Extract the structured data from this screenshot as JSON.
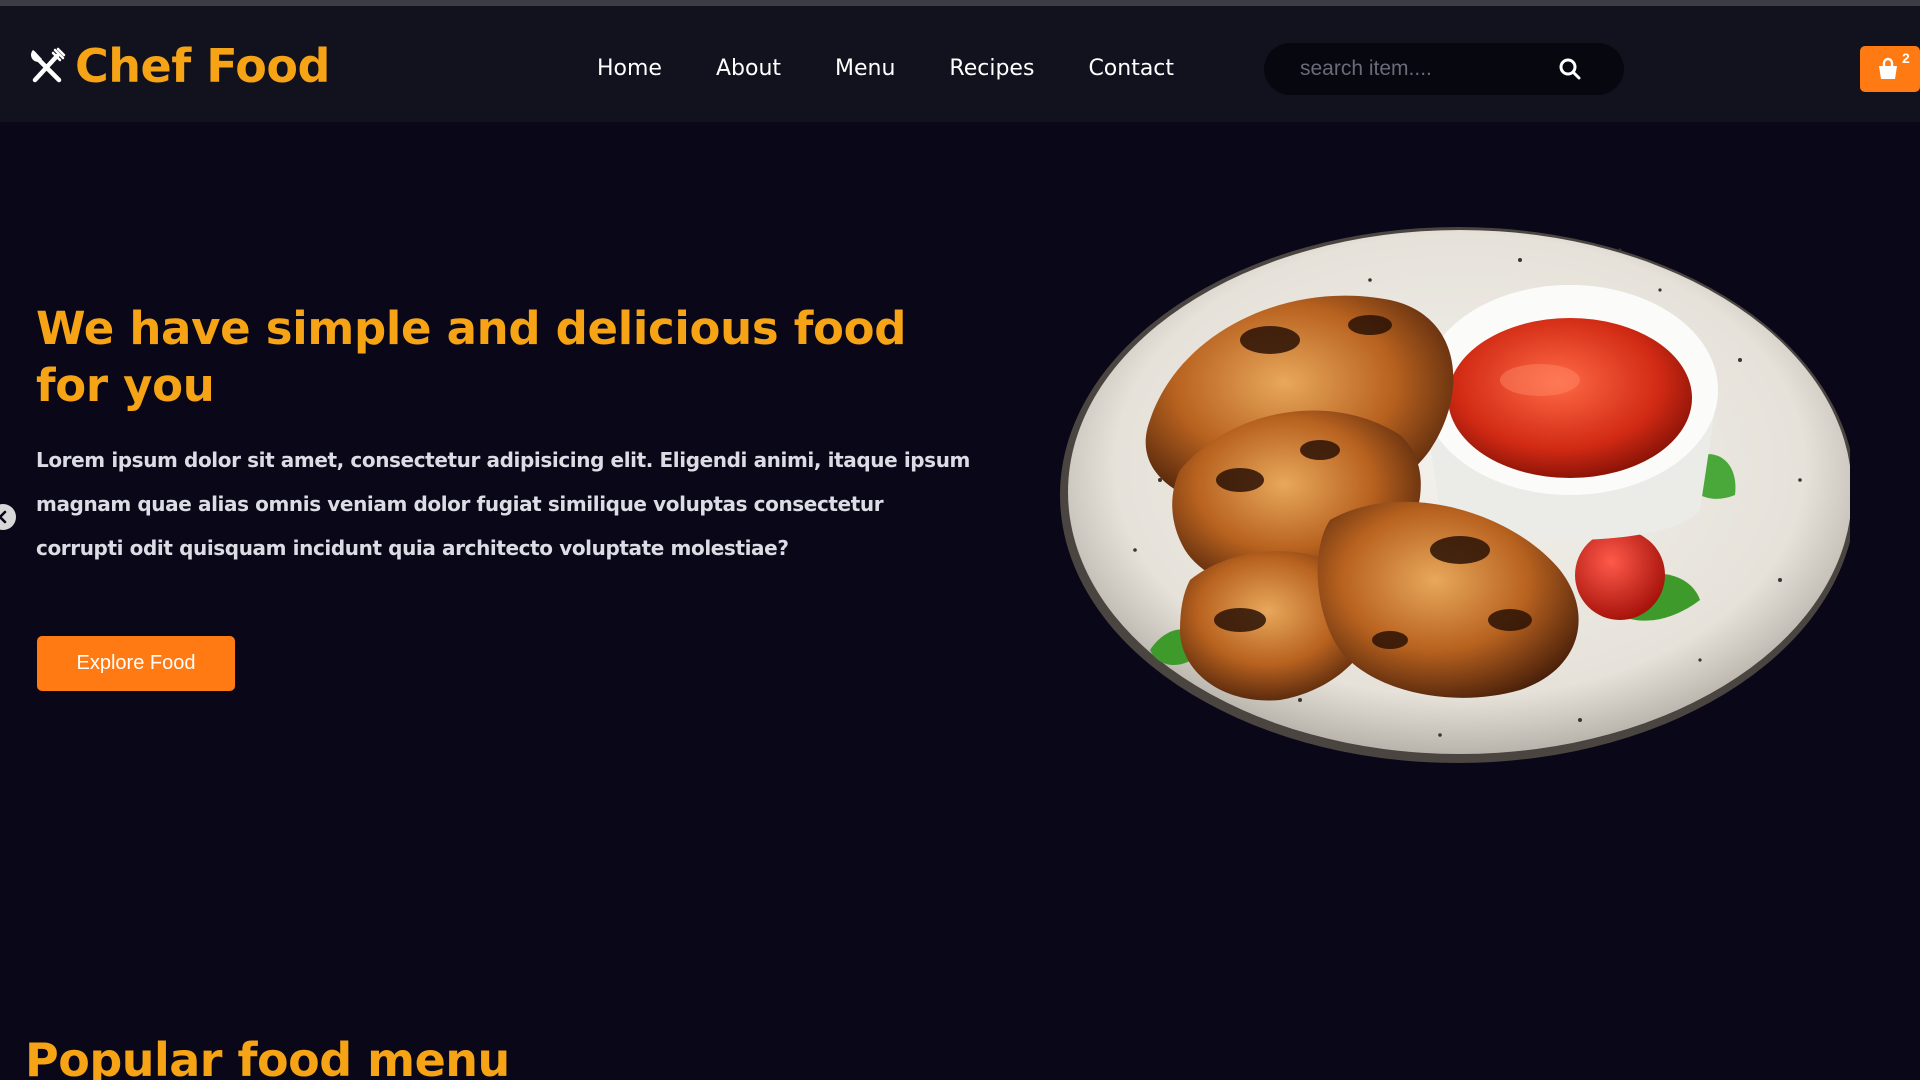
{
  "brand": {
    "name": "Chef Food",
    "icon": "fork-knife-icon"
  },
  "nav": {
    "items": [
      {
        "label": "Home"
      },
      {
        "label": "About"
      },
      {
        "label": "Menu"
      },
      {
        "label": "Recipes"
      },
      {
        "label": "Contact"
      }
    ]
  },
  "search": {
    "placeholder": "search item....",
    "icon": "search-icon"
  },
  "cart": {
    "icon": "shopping-bag-icon",
    "count": "2"
  },
  "hero": {
    "title": "We have simple and delicious food for you",
    "text": "Lorem ipsum dolor sit amet, consectetur adipisicing elit. Eligendi animi, itaque ipsum magnam quae alias omnis veniam dolor fugiat similique voluptas consectetur corrupti odit quisquam incidunt quia architecto voluptate molestiae?",
    "button_label": "Explore Food",
    "image": "grilled-chicken-wings-plate-image",
    "prev_icon": "chevron-left-icon"
  },
  "section": {
    "title": "Popular food menu"
  },
  "colors": {
    "background": "#0a0818",
    "header": "#12121e",
    "accent_yellow": "#f6a416",
    "accent_orange": "#ff7a12"
  }
}
